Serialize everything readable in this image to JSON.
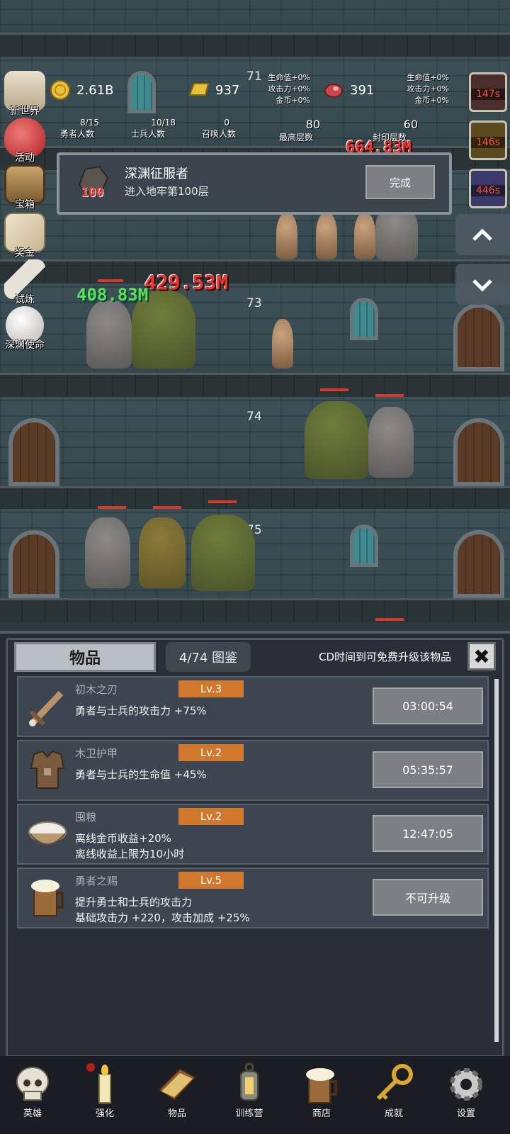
{
  "scene": {
    "floors": [
      "71",
      "73",
      "74",
      "75"
    ],
    "damage_numbers": [
      "429.53M",
      "408.83M",
      "664.83M"
    ]
  },
  "left_menu": [
    {
      "label": "新世界",
      "icon": "map-icon"
    },
    {
      "label": "活动",
      "icon": "heart-icon"
    },
    {
      "label": "宝箱",
      "icon": "chest-icon"
    },
    {
      "label": "奖金",
      "icon": "envelope-icon"
    },
    {
      "label": "试炼",
      "icon": "feather-icon"
    },
    {
      "label": "深渊使命",
      "icon": "pearl-icon"
    }
  ],
  "stats": {
    "gold": "2.61B",
    "gold_bars": "937",
    "meat": "391",
    "bonus_a": [
      "生命值+0%",
      "攻击力+0%",
      "金币+0%"
    ],
    "bonus_b": [
      "生命值+0%",
      "攻击力+0%",
      "金币+0%"
    ],
    "heroes": {
      "value": "8/15",
      "label": "勇者人数"
    },
    "soldiers": {
      "value": "10/18",
      "label": "士兵人数"
    },
    "summons": {
      "value": "0",
      "label": "召唤人数"
    },
    "max_floor": {
      "value": "80",
      "label": "最高层数"
    },
    "seal_floor": {
      "value": "60",
      "label": "封印层数"
    }
  },
  "right_timers": [
    "147s",
    "146s",
    "446s"
  ],
  "achievement": {
    "badge": "100",
    "title": "深渊征服者",
    "desc": "进入地牢第100层",
    "button": "完成"
  },
  "items_panel": {
    "tab_label": "物品",
    "count_label": "4/74 图鉴",
    "cd_note": "CD时间到可免费升级该物品",
    "items": [
      {
        "name": "初木之刃",
        "level": "Lv.3",
        "line1": "勇者与士兵的攻击力 +75%",
        "line2": "",
        "action": "03:00:54",
        "icon": "wooden-sword-icon"
      },
      {
        "name": "木卫护甲",
        "level": "Lv.2",
        "line1": "勇者与士兵的生命值 +45%",
        "line2": "",
        "action": "05:35:57",
        "icon": "leather-armor-icon"
      },
      {
        "name": "囤粮",
        "level": "Lv.2",
        "line1": "离线金币收益+20%",
        "line2": "离线收益上限为10小时",
        "action": "12:47:05",
        "icon": "rice-bowl-icon"
      },
      {
        "name": "勇者之赐",
        "level": "Lv.5",
        "line1": "提升勇士和士兵的攻击力",
        "line2": "基础攻击力 +220，攻击加成 +25%",
        "action": "不可升级",
        "icon": "beer-mug-icon"
      }
    ]
  },
  "bottom_nav": [
    {
      "label": "英雄",
      "icon": "skull-icon"
    },
    {
      "label": "强化",
      "icon": "candle-icon"
    },
    {
      "label": "物品",
      "icon": "book-icon"
    },
    {
      "label": "训练营",
      "icon": "lantern-icon"
    },
    {
      "label": "商店",
      "icon": "beer-mug-icon"
    },
    {
      "label": "成就",
      "icon": "key-icon"
    },
    {
      "label": "设置",
      "icon": "gear-icon"
    }
  ]
}
